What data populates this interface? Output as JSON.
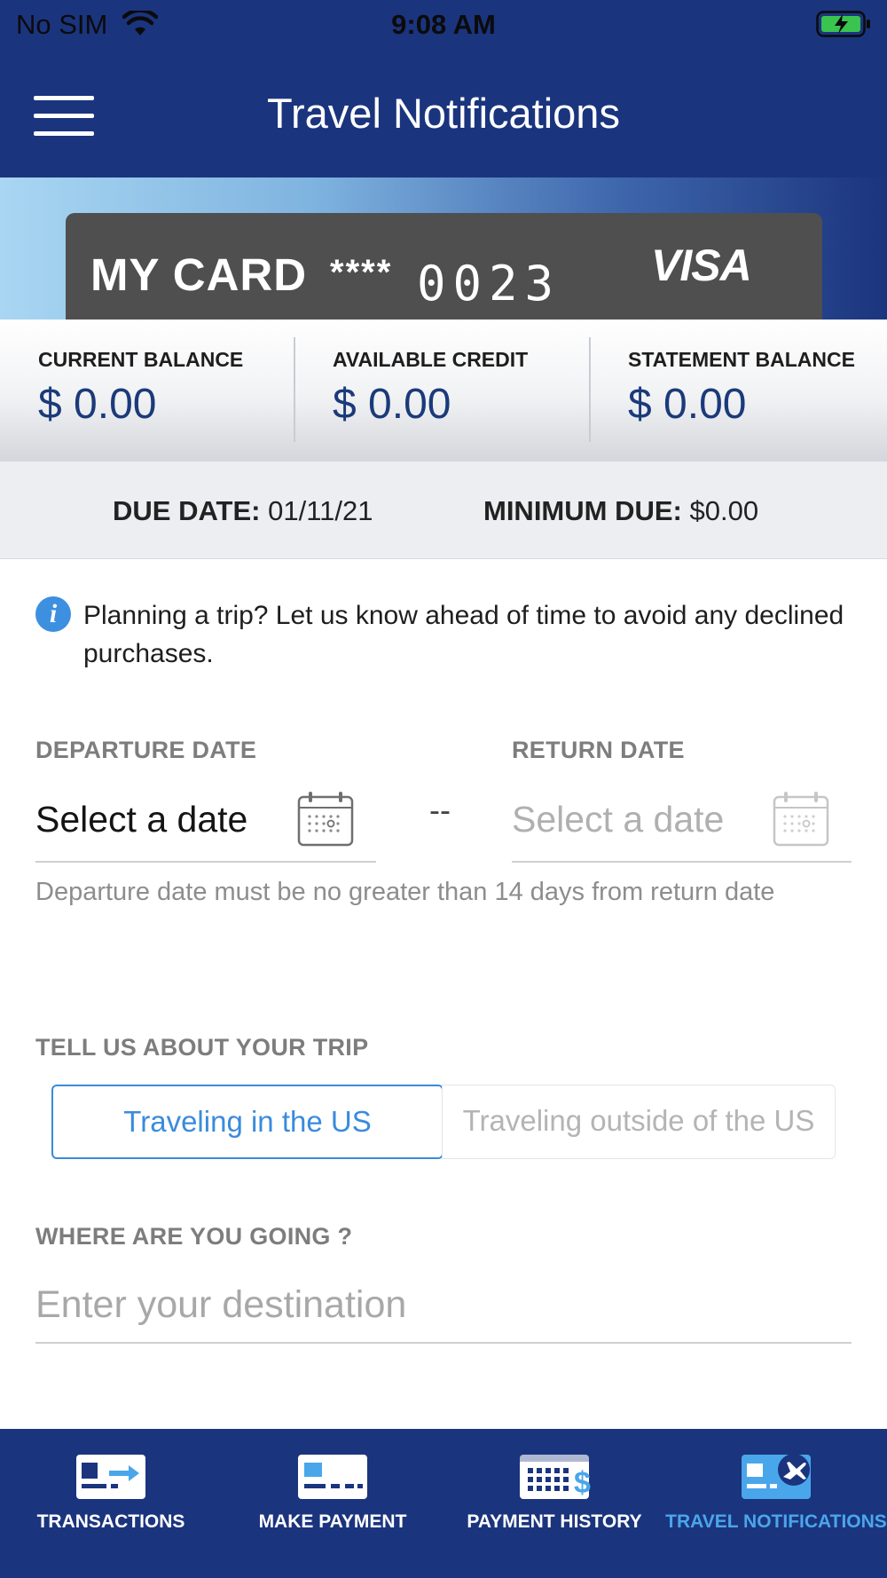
{
  "status_bar": {
    "carrier": "No SIM",
    "time": "9:08 AM"
  },
  "header": {
    "title": "Travel Notifications"
  },
  "card": {
    "name": "MY CARD",
    "mask": "****",
    "last4": "0023",
    "network": "VISA"
  },
  "balances": [
    {
      "label": "CURRENT BALANCE",
      "value": "$ 0.00"
    },
    {
      "label": "AVAILABLE CREDIT",
      "value": "$ 0.00"
    },
    {
      "label": "STATEMENT BALANCE",
      "value": "$ 0.00"
    }
  ],
  "due": {
    "due_date_label": "DUE DATE:",
    "due_date_value": "01/11/21",
    "minimum_due_label": "MINIMUM DUE:",
    "minimum_due_value": "$0.00"
  },
  "info": {
    "text": "Planning a trip? Let us know ahead of time to avoid any declined purchases."
  },
  "dates": {
    "departure_label": "DEPARTURE DATE",
    "departure_value": "Select a date",
    "separator": "--",
    "return_label": "RETURN DATE",
    "return_value": "Select a date",
    "hint": "Departure date must be no greater than 14 days from return date"
  },
  "trip": {
    "label": "TELL US ABOUT YOUR TRIP",
    "options": [
      "Traveling in the US",
      "Traveling outside of the US"
    ],
    "selected": "Traveling in the US"
  },
  "destination": {
    "label": "WHERE ARE YOU GOING ?",
    "placeholder": "Enter your destination"
  },
  "tabs": [
    {
      "label": "TRANSACTIONS",
      "icon": "transactions-icon"
    },
    {
      "label": "MAKE PAYMENT",
      "icon": "make-payment-icon"
    },
    {
      "label": "PAYMENT HISTORY",
      "icon": "payment-history-icon"
    },
    {
      "label": "TRAVEL NOTIFICATIONS",
      "icon": "travel-notifications-icon",
      "active": true
    }
  ],
  "colors": {
    "primary": "#1b347e",
    "accent": "#3a8bdc",
    "card": "#4f4f4f",
    "balance_value": "#1b3a7a"
  }
}
